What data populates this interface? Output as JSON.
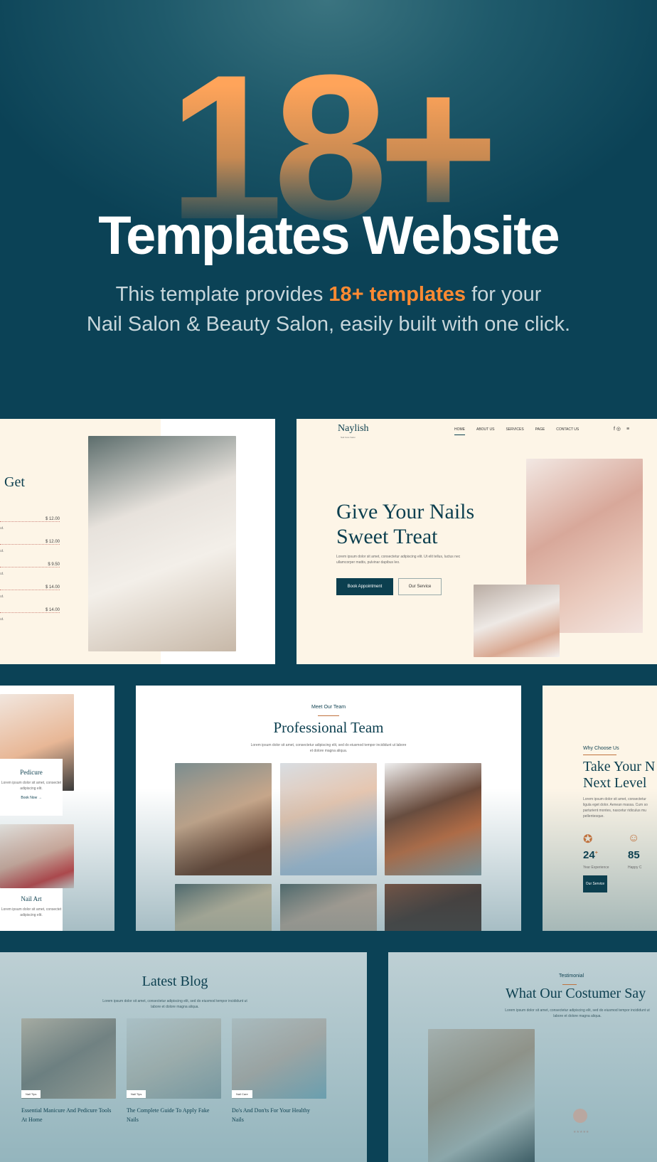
{
  "hero": {
    "big_number": "18+",
    "title": "Templates Website",
    "subtitle_pre": "This template provides ",
    "subtitle_highlight": "18+ templates",
    "subtitle_post": " for your",
    "subtitle_line2": "Nail Salon & Beauty Salon, easily built with one click.",
    "accent": "#ff8a32",
    "background": "#0b4256"
  },
  "pricing_panel": {
    "heading_fragment": "Get",
    "prices": [
      "$ 12.00",
      "$ 12.00",
      "$ 9.50",
      "$ 14.00",
      "$ 14.00"
    ],
    "row_fragment": "ut."
  },
  "home_panel": {
    "logo": "Naylish",
    "tagline": "Nail Care Salon",
    "nav": [
      "HOME",
      "ABOUT US",
      "SERVICES",
      "PAGE",
      "CONTACT US"
    ],
    "title_line1": "Give Your Nails",
    "title_line2": "Sweet Treat",
    "body": "Lorem ipsum dolor sit amet, consectetur adipiscing elit. Ut elit tellus, luctus nec ullamcorper mattis, pulvinar dapibus leo.",
    "primary_button": "Book Appointment",
    "secondary_button": "Our Service"
  },
  "services_panel": {
    "items": [
      {
        "title": "Pedicure",
        "body": "Lorem ipsum dolor sit amet, consectet adipiscing elit.",
        "link": "Book Now"
      },
      {
        "title": "Nail Art",
        "body": "Lorem ipsum dolor sit amet, consectet adipiscing elit."
      }
    ]
  },
  "team_panel": {
    "eyebrow": "Meet Our Team",
    "title": "Professional Team",
    "body": "Lorem ipsum dolor sit amet, consectetur adipiscing elit, sed do eiusmod tempor incididunt ut labore et dolore magna aliqua."
  },
  "why_panel": {
    "eyebrow": "Why Choose Us",
    "title_line1": "Take Your N",
    "title_line2": "Next Level",
    "body": "Lorem ipsum dolor sit amet, consectetur ligula eget dolor. Aenean massa. Cum so parturient montes, nascetur ridiculus mu pellentesque.",
    "stats": [
      {
        "value": "24",
        "suffix": "+",
        "label": "Year Experience"
      },
      {
        "value": "85",
        "label": "Happy C"
      }
    ],
    "button": "Our Service"
  },
  "blog_panel": {
    "title": "Latest Blog",
    "body": "Lorem ipsum dolor sit amet, consectetur adipiscing elit, sed do eiusmod tempor incididunt ut labore et dolore magna aliqua.",
    "posts": [
      {
        "tag": "Nail Tips",
        "title": "Essential Manicure And Pedicure Tools At Home"
      },
      {
        "tag": "Nail Tips",
        "title": "The Complete Guide To Apply Fake Nails"
      },
      {
        "tag": "Nail Care",
        "title": "Do's And Don'ts For Your Healthy Nails"
      }
    ]
  },
  "testimonial_panel": {
    "eyebrow": "Testimonial",
    "title": "What Our Costumer Say",
    "body": "Lorem ipsum dolor sit amet, consectetur adipiscing elit, sed do eiusmod tempor incididunt ut labore et dolore magna aliqua."
  }
}
